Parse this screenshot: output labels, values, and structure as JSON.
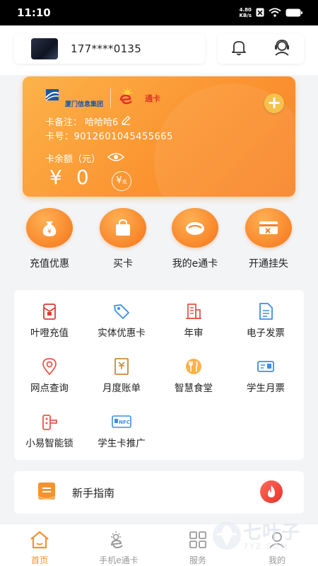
{
  "status_bar": {
    "time": "11:10",
    "net_speed_value": "4.80",
    "net_speed_unit": "KB/s"
  },
  "account": {
    "phone": "177****0135"
  },
  "card": {
    "remark_label": "卡备注：",
    "remark_value": "哈哈哈6",
    "number_label": "卡号：",
    "number_value": "9012601045455665",
    "balance_label": "卡余额（元）",
    "currency": "¥",
    "balance_value": "0",
    "recharge_symbol": "¥",
    "recharge_text": "充",
    "logo_text": "厦门信息集团",
    "brand_text": "通卡",
    "add_symbol": "+"
  },
  "quick_actions": [
    {
      "label": "充值优惠",
      "icon": "money-bag-icon"
    },
    {
      "label": "买卡",
      "icon": "shopping-bag-icon"
    },
    {
      "label": "我的e通卡",
      "icon": "card-pouch-icon"
    },
    {
      "label": "开通挂失",
      "icon": "card-lost-icon"
    }
  ],
  "services": [
    {
      "label": "叶噔充值",
      "icon": "red-packet-icon"
    },
    {
      "label": "实体优惠卡",
      "icon": "tag-icon"
    },
    {
      "label": "年审",
      "icon": "building-icon"
    },
    {
      "label": "电子发票",
      "icon": "document-icon"
    },
    {
      "label": "网点查询",
      "icon": "location-icon"
    },
    {
      "label": "月度账单",
      "icon": "bill-icon"
    },
    {
      "label": "智慧食堂",
      "icon": "canteen-icon"
    },
    {
      "label": "学生月票",
      "icon": "ticket-icon"
    },
    {
      "label": "小易智能锁",
      "icon": "smart-lock-icon"
    },
    {
      "label": "学生卡推广",
      "icon": "nfc-card-icon"
    }
  ],
  "nfc_text": "NFC",
  "guide": {
    "label": "新手指南"
  },
  "tabs": [
    {
      "label": "首页",
      "active": true
    },
    {
      "label": "手机e通卡",
      "active": false
    },
    {
      "label": "服务",
      "active": false
    },
    {
      "label": "我的",
      "active": false
    }
  ],
  "watermark": {
    "text": "七叶子",
    "sub": "7YZ.COM"
  },
  "colors": {
    "accent": "#f7932c",
    "card_start": "#fcb24a",
    "card_end": "#f8842a",
    "tab_inactive": "#999999"
  }
}
